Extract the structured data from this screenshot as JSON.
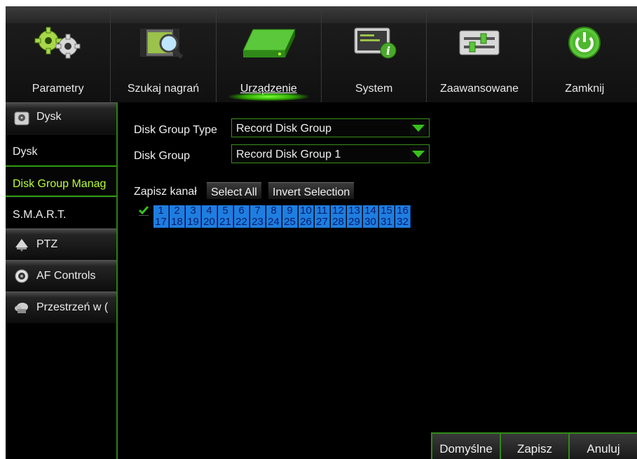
{
  "top_menu": {
    "items": [
      {
        "label": "Parametry",
        "icon": "gears-icon"
      },
      {
        "label": "Szukaj nagrań",
        "icon": "search-recording-icon"
      },
      {
        "label": "Urządzenie",
        "icon": "hard-drive-icon",
        "active": true
      },
      {
        "label": "System",
        "icon": "system-info-icon"
      },
      {
        "label": "Zaawansowane",
        "icon": "sliders-icon"
      },
      {
        "label": "Zamknij",
        "icon": "power-icon"
      }
    ]
  },
  "sidebar": {
    "groups": [
      {
        "label": "Dysk",
        "icon": "disk-icon"
      },
      {
        "label": "PTZ",
        "icon": "ptz-camera-icon"
      },
      {
        "label": "AF Controls",
        "icon": "af-lens-icon"
      },
      {
        "label": "Przestrzeń w (",
        "icon": "cloud-storage-icon"
      }
    ],
    "sub_items": [
      {
        "label": "Dysk"
      },
      {
        "label": "Disk Group Manag",
        "active": true
      },
      {
        "label": "S.M.A.R.T."
      }
    ]
  },
  "form": {
    "disk_group_type_label": "Disk Group Type",
    "disk_group_type_value": "Record Disk Group",
    "disk_group_label": "Disk Group",
    "disk_group_value": "Record Disk Group 1",
    "record_channel_label": "Zapisz kanał",
    "select_all_label": "Select All",
    "invert_selection_label": "Invert Selection",
    "channels": [
      "1",
      "2",
      "3",
      "4",
      "5",
      "6",
      "7",
      "8",
      "9",
      "10",
      "11",
      "12",
      "13",
      "14",
      "15",
      "16",
      "17",
      "18",
      "19",
      "20",
      "21",
      "22",
      "23",
      "24",
      "25",
      "26",
      "27",
      "28",
      "29",
      "30",
      "31",
      "32"
    ]
  },
  "footer": {
    "default_label": "Domyślne",
    "save_label": "Zapisz",
    "cancel_label": "Anuluj"
  },
  "colors": {
    "accent_green": "#36c21a",
    "channel_blue": "#1e7ee0",
    "active_text": "#b9ff38"
  }
}
